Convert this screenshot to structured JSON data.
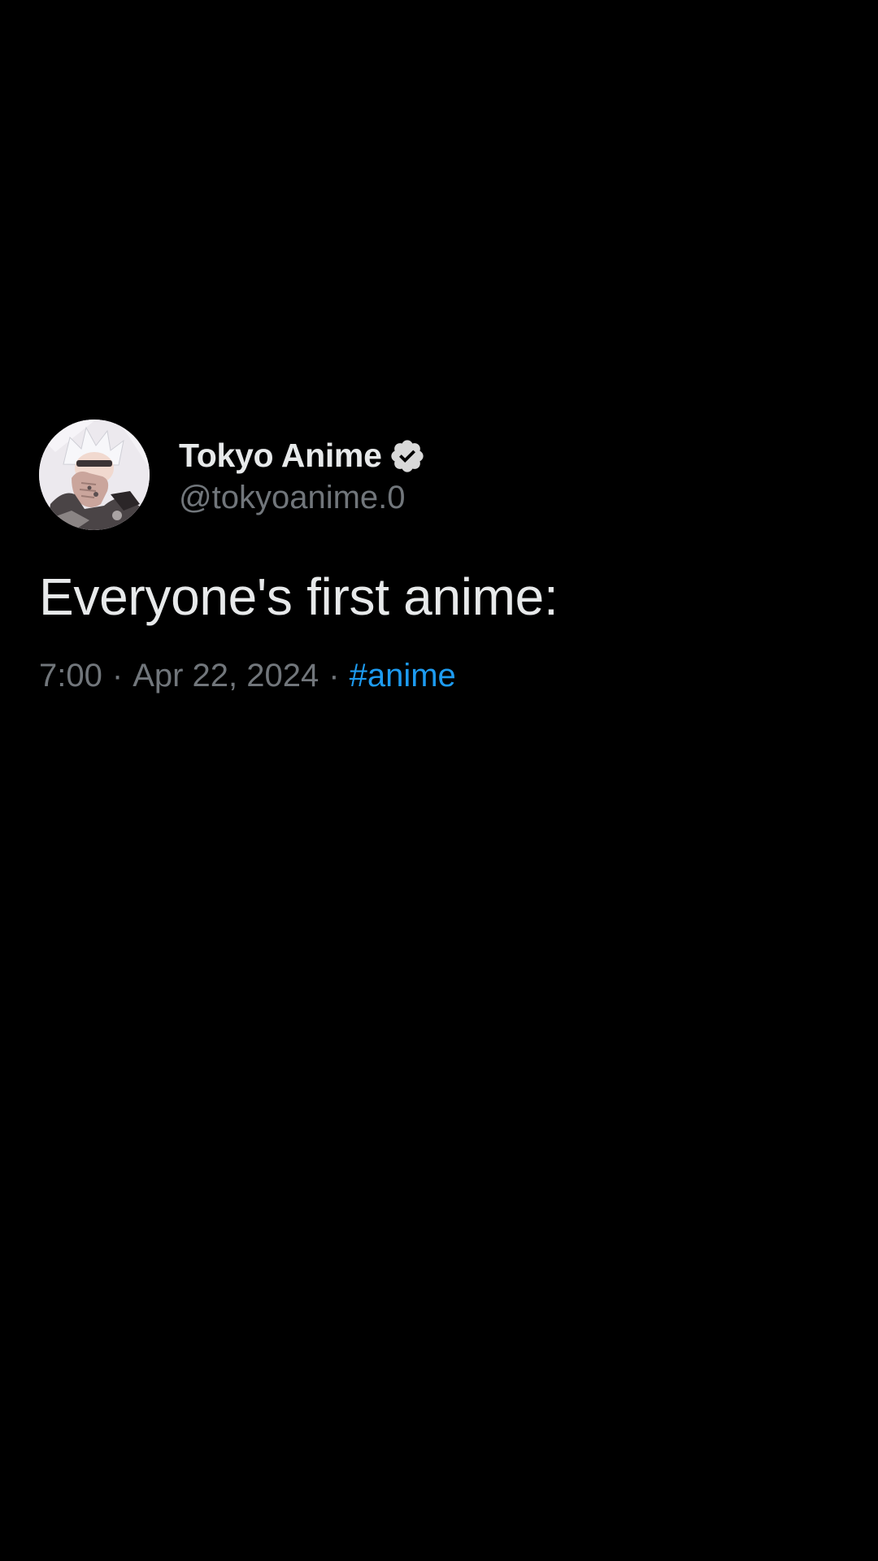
{
  "tweet": {
    "author": {
      "display_name": "Tokyo Anime",
      "handle": "@tokyoanime.0",
      "verified": true,
      "avatar_icon": "anime-character-avatar"
    },
    "text": "Everyone's first anime:",
    "meta": {
      "time": "7:00",
      "separator": "·",
      "date": "Apr 22, 2024",
      "hashtag": "#anime"
    }
  },
  "colors": {
    "background": "#000000",
    "primary_text": "#e7e9ea",
    "secondary_text": "#71767b",
    "link": "#1d9bf0"
  }
}
